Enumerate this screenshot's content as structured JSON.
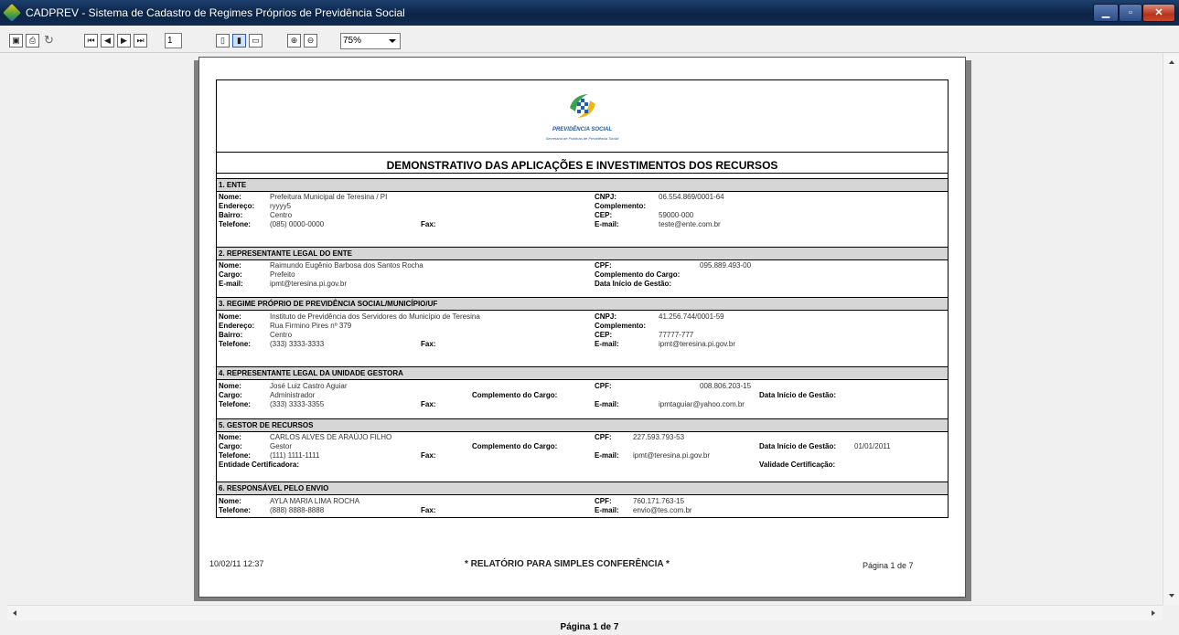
{
  "window": {
    "title": "CADPREV - Sistema de Cadastro de Regimes Próprios de Previdência Social"
  },
  "toolbar": {
    "page_number": "1",
    "zoom": "75%"
  },
  "status": {
    "page_label": "Página 1 de 7"
  },
  "report": {
    "logo_text": "PREVIDÊNCIA SOCIAL",
    "logo_sub": "Secretaria de Políticas de Previdência Social",
    "title": "DEMONSTRATIVO DAS APLICAÇÕES E INVESTIMENTOS DOS RECURSOS",
    "s1": {
      "head": "1. ENTE",
      "nome_l": "Nome:",
      "nome": "Prefeitura Municipal de Teresina / PI",
      "end_l": "Endereço:",
      "end": "ryyyy5",
      "bairro_l": "Bairro:",
      "bairro": "Centro",
      "tel_l": "Telefone:",
      "tel": "(085) 0000-0000",
      "fax_l": "Fax:",
      "cnpj_l": "CNPJ:",
      "cnpj": "06.554.869/0001-64",
      "comp_l": "Complemento:",
      "cep_l": "CEP:",
      "cep": "59000-000",
      "email_l": "E-mail:",
      "email": "teste@ente.com.br"
    },
    "s2": {
      "head": "2. REPRESENTANTE LEGAL DO ENTE",
      "nome_l": "Nome:",
      "nome": "Raimundo Eugênio Barbosa dos Santos Rocha",
      "cargo_l": "Cargo:",
      "cargo": "Prefeito",
      "email_l": "E-mail:",
      "email": "ipmt@teresina.pi.gov.br",
      "cpf_l": "CPF:",
      "cpf": "095.889.493-00",
      "compc_l": "Complemento do Cargo:",
      "data_l": "Data Início de Gestão:"
    },
    "s3": {
      "head": "3. REGIME PRÓPRIO DE PREVIDÊNCIA SOCIAL/MUNICÍPIO/UF",
      "nome_l": "Nome:",
      "nome": "Instituto de Previdência dos Servidores do Município de Teresina",
      "end_l": "Endereço:",
      "end": "Rua Firmino Pires nº 379",
      "bairro_l": "Bairro:",
      "bairro": "Centro",
      "tel_l": "Telefone:",
      "tel": "(333) 3333-3333",
      "fax_l": "Fax:",
      "cnpj_l": "CNPJ:",
      "cnpj": "41.256.744/0001-59",
      "comp_l": "Complemento:",
      "cep_l": "CEP:",
      "cep": "77777-777",
      "email_l": "E-mail:",
      "email": "ipmt@teresina.pi.gov.br"
    },
    "s4": {
      "head": "4. REPRESENTANTE LEGAL DA UNIDADE GESTORA",
      "nome_l": "Nome:",
      "nome": "José Luiz Castro Aguiar",
      "cargo_l": "Cargo:",
      "cargo": "Administrador",
      "tel_l": "Telefone:",
      "tel": "(333) 3333-3355",
      "fax_l": "Fax:",
      "compc_l": "Complemento do Cargo:",
      "cpf_l": "CPF:",
      "cpf": "008.806.203-15",
      "email_l": "E-mail:",
      "email": "ipmtaguiar@yahoo.com.br",
      "data_l": "Data Início de Gestão:"
    },
    "s5": {
      "head": "5. GESTOR DE RECURSOS",
      "nome_l": "Nome:",
      "nome": "CARLOS ALVES DE ARAÚJO FILHO",
      "cargo_l": "Cargo:",
      "cargo": "Gestor",
      "tel_l": "Telefone:",
      "tel": "(111) 1111-1111",
      "fax_l": "Fax:",
      "ent_l": "Entidade Certificadora:",
      "compc_l": "Complemento do Cargo:",
      "cpf_l": "CPF:",
      "cpf": "227.593.793-53",
      "email_l": "E-mail:",
      "email": "ipmt@teresina.pi.gov.br",
      "data_l": "Data Início de Gestão:",
      "data": "01/01/2011",
      "val_l": "Validade Certificação:"
    },
    "s6": {
      "head": "6. RESPONSÁVEL PELO ENVIO",
      "nome_l": "Nome:",
      "nome": "AYLA MARIA LIMA ROCHA",
      "tel_l": "Telefone:",
      "tel": "(888) 8888-8888",
      "fax_l": "Fax:",
      "cpf_l": "CPF:",
      "cpf": "760.171.763-15",
      "email_l": "E-mail:",
      "email": "envio@tes.com.br"
    },
    "footer": {
      "datetime": "10/02/11 12:37",
      "note": "* RELATÓRIO PARA SIMPLES CONFERÊNCIA *",
      "page": "Página 1 de 7"
    }
  }
}
